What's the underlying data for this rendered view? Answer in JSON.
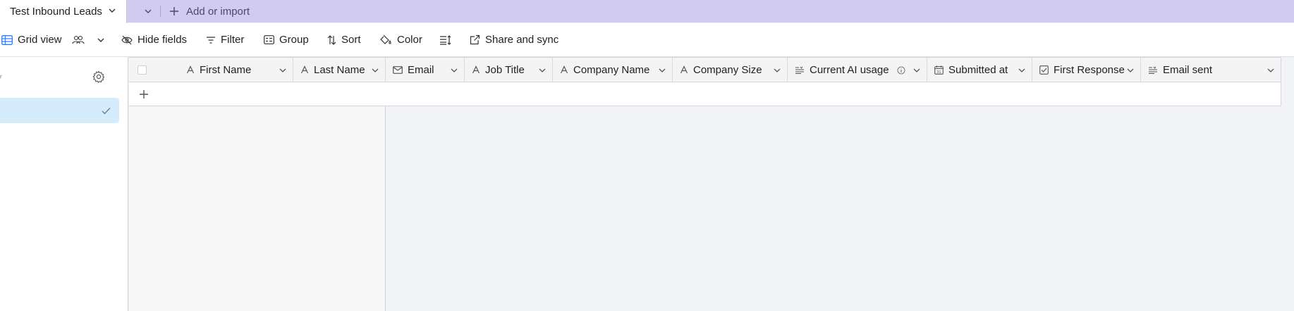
{
  "tabbar": {
    "active_table": "Test Inbound Leads",
    "add_import": "Add or import"
  },
  "toolbar": {
    "view_name": "Grid view",
    "hide_fields": "Hide fields",
    "filter": "Filter",
    "group": "Group",
    "sort": "Sort",
    "color": "Color",
    "share": "Share and sync"
  },
  "grid": {
    "columns": [
      {
        "label": "First Name",
        "icon": "text-icon"
      },
      {
        "label": "Last Name",
        "icon": "text-icon"
      },
      {
        "label": "Email",
        "icon": "email-icon"
      },
      {
        "label": "Job Title",
        "icon": "text-icon"
      },
      {
        "label": "Company Name",
        "icon": "text-icon"
      },
      {
        "label": "Company Size",
        "icon": "text-icon"
      },
      {
        "label": "Current AI usage",
        "icon": "long-text-icon"
      },
      {
        "label": "Submitted at",
        "icon": "calendar-icon"
      },
      {
        "label": "First Response",
        "icon": "checkbox-icon"
      },
      {
        "label": "Email sent",
        "icon": "long-text-icon"
      }
    ]
  },
  "colors": {
    "tabbar_bg": "#d1cbf2",
    "selected_view_bg": "#d4ecfb",
    "grid_bg": "#f2f3f7",
    "view_icon": "#2d7ff9"
  }
}
